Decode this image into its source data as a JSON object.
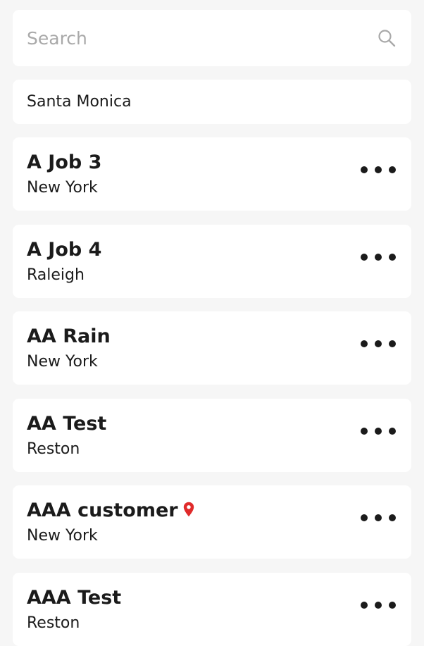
{
  "search": {
    "placeholder": "Search",
    "icon": "search-icon"
  },
  "location_filter": {
    "value": "Santa Monica"
  },
  "jobs": [
    {
      "title": "A Job 3",
      "city": "New York",
      "has_pin": false
    },
    {
      "title": "A Job 4",
      "city": "Raleigh",
      "has_pin": false
    },
    {
      "title": "AA Rain",
      "city": "New York",
      "has_pin": false
    },
    {
      "title": "AA Test",
      "city": "Reston",
      "has_pin": false
    },
    {
      "title": "AAA customer",
      "city": "New York",
      "has_pin": true
    },
    {
      "title": "AAA Test",
      "city": "Reston",
      "has_pin": false
    }
  ],
  "colors": {
    "background": "#f6f6f6",
    "card": "#ffffff",
    "text": "#1b1b1b",
    "placeholder": "#a9a9a9",
    "pin": "#e02a2a"
  },
  "icons": {
    "more": "more-horizontal-icon",
    "pin": "location-pin-icon"
  }
}
